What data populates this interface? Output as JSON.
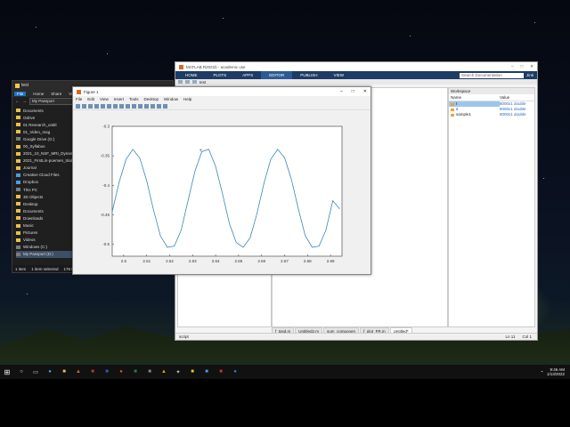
{
  "explorer": {
    "title": "test",
    "ribbon": [
      "File",
      "Home",
      "Share",
      "View"
    ],
    "address": "My Passport",
    "items": [
      {
        "label": "Documents",
        "icon": "folder-icon"
      },
      {
        "label": "Odrive",
        "icon": "folder-icon"
      },
      {
        "label": "01 Research_untitl",
        "icon": "folder-icon"
      },
      {
        "label": "01_Video_mag",
        "icon": "folder-icon"
      },
      {
        "label": "Google Drive (G:)",
        "icon": "drive-icon"
      },
      {
        "label": "00_Syllabus",
        "icon": "folder-icon"
      },
      {
        "label": "2021_10_NSF_MRI_Dynamic",
        "icon": "folder-icon"
      },
      {
        "label": "2021_FirstLin-poemen_trial_o",
        "icon": "folder-icon"
      },
      {
        "label": "Journal",
        "icon": "folder-icon"
      },
      {
        "label": "Creative Cloud Files",
        "icon": "cloud-icon"
      },
      {
        "label": "Dropbox",
        "icon": "dropbox-icon"
      },
      {
        "label": "This PC",
        "icon": "pc-icon"
      },
      {
        "label": "3D Objects",
        "icon": "folder-icon"
      },
      {
        "label": "Desktop",
        "icon": "folder-icon"
      },
      {
        "label": "Documents",
        "icon": "folder-icon"
      },
      {
        "label": "Downloads",
        "icon": "folder-icon"
      },
      {
        "label": "Music",
        "icon": "folder-icon"
      },
      {
        "label": "Pictures",
        "icon": "folder-icon"
      },
      {
        "label": "Videos",
        "icon": "folder-icon"
      },
      {
        "label": "Windows (C:)",
        "icon": "drive-icon"
      },
      {
        "label": "My Passport (D:)",
        "icon": "drive-icon"
      }
    ],
    "status": [
      "1 item",
      "1 item selected",
      "176 KB"
    ]
  },
  "matlab": {
    "title": "MATLAB R2021b - academic use",
    "tabs": [
      "HOME",
      "PLOTS",
      "APPS",
      "EDITOR",
      "PUBLISH",
      "VIEW"
    ],
    "search_placeholder": "Search Documentation",
    "user": "Jinti",
    "path": "test",
    "workspace": {
      "header": "Workspace",
      "col_name": "Name",
      "col_value": "Value",
      "rows": [
        {
          "name": "t",
          "value": "8000x1 double"
        },
        {
          "name": "s",
          "value": "8000x1 double"
        },
        {
          "name": "sample1",
          "value": "8000x1 double"
        }
      ]
    },
    "editor_tabs": [
      "f_tgsd.m",
      "Untitled2.m",
      "sum_componen",
      "f_plot_FR.m",
      "Untitled*"
    ],
    "status": {
      "left": "script",
      "ln": "Ln 11",
      "col": "Col 1"
    }
  },
  "figure": {
    "title": "Figure 1",
    "menu": [
      "File",
      "Edit",
      "View",
      "Insert",
      "Tools",
      "Desktop",
      "Window",
      "Help"
    ]
  },
  "chart_data": {
    "type": "line",
    "xlim": [
      2.595,
      2.695
    ],
    "ylim": [
      -0.52,
      -0.3
    ],
    "xticks": [
      2.6,
      2.61,
      2.62,
      2.63,
      2.64,
      2.65,
      2.66,
      2.67,
      2.68,
      2.69
    ],
    "yticks": [
      -0.3,
      -0.35,
      -0.4,
      -0.45,
      -0.5
    ],
    "xtick_labels": [
      "2.6",
      "2.61",
      "2.62",
      "2.63",
      "2.64",
      "2.65",
      "2.66",
      "2.67",
      "2.68",
      "2.69"
    ],
    "ytick_labels": [
      "-0.3",
      "-0.35",
      "-0.4",
      "-0.45",
      "-0.5"
    ],
    "series": [
      {
        "color": "#3b87b8",
        "x": [
          2.595,
          2.598,
          2.601,
          2.604,
          2.607,
          2.61,
          2.613,
          2.616,
          2.619,
          2.622,
          2.625,
          2.628,
          2.631,
          2.634,
          2.637,
          2.64,
          2.643,
          2.646,
          2.649,
          2.652,
          2.655,
          2.658,
          2.661,
          2.664,
          2.667,
          2.67,
          2.673,
          2.676,
          2.679,
          2.682,
          2.685,
          2.688,
          2.691,
          2.694
        ],
        "y": [
          -0.445,
          -0.395,
          -0.356,
          -0.339,
          -0.354,
          -0.392,
          -0.442,
          -0.486,
          -0.505,
          -0.503,
          -0.476,
          -0.426,
          -0.376,
          -0.343,
          -0.339,
          -0.368,
          -0.414,
          -0.465,
          -0.497,
          -0.505,
          -0.489,
          -0.448,
          -0.397,
          -0.356,
          -0.339,
          -0.353,
          -0.39,
          -0.44,
          -0.485,
          -0.505,
          -0.503,
          -0.476,
          -0.426,
          -0.44
        ]
      }
    ]
  },
  "taskbar": {
    "time": "9:46 AM",
    "date": "1/13/2022"
  }
}
